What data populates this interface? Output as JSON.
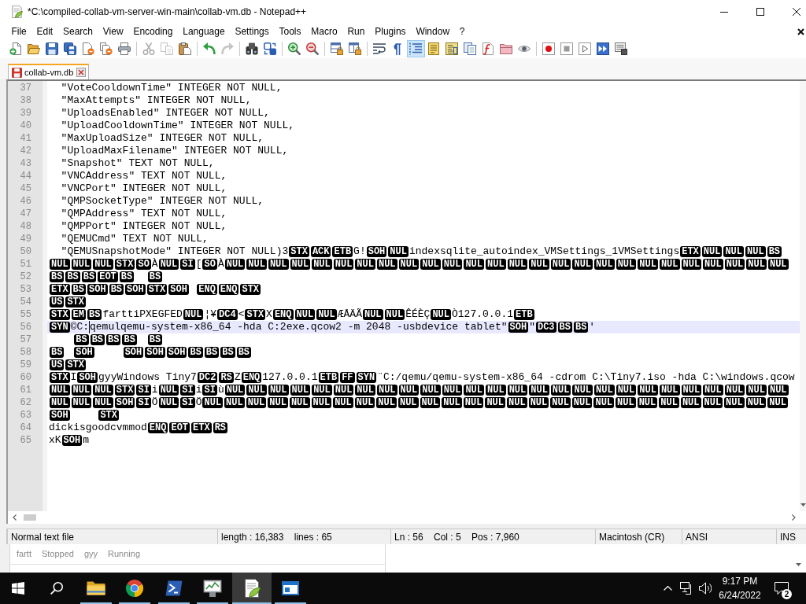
{
  "window": {
    "title": "*C:\\compiled-collab-vm-server-win-main\\collab-vm.db - Notepad++"
  },
  "menu": [
    "File",
    "Edit",
    "Search",
    "View",
    "Encoding",
    "Language",
    "Settings",
    "Tools",
    "Macro",
    "Run",
    "Plugins",
    "Window",
    "?"
  ],
  "toolbar": [
    {
      "buttons": [
        {
          "kind": "new",
          "pressed": false,
          "disabled": false
        },
        {
          "kind": "open",
          "pressed": false,
          "disabled": false
        },
        {
          "kind": "save",
          "pressed": false,
          "disabled": false
        },
        {
          "kind": "save_all",
          "pressed": false,
          "disabled": false
        },
        {
          "kind": "close",
          "pressed": false,
          "disabled": false
        },
        {
          "kind": "close_all",
          "pressed": false,
          "disabled": false
        },
        {
          "kind": "print",
          "pressed": false,
          "disabled": false
        }
      ]
    },
    {
      "buttons": [
        {
          "kind": "cut",
          "pressed": false,
          "disabled": true
        },
        {
          "kind": "copy",
          "pressed": false,
          "disabled": true
        },
        {
          "kind": "paste",
          "pressed": false,
          "disabled": false
        }
      ]
    },
    {
      "buttons": [
        {
          "kind": "undo",
          "pressed": false,
          "disabled": false
        },
        {
          "kind": "redo",
          "pressed": false,
          "disabled": true
        }
      ]
    },
    {
      "buttons": [
        {
          "kind": "find",
          "pressed": false,
          "disabled": false
        },
        {
          "kind": "replace",
          "pressed": false,
          "disabled": false
        }
      ]
    },
    {
      "buttons": [
        {
          "kind": "zoom_in",
          "pressed": false,
          "disabled": false
        },
        {
          "kind": "zoom_out",
          "pressed": false,
          "disabled": false
        }
      ]
    },
    {
      "buttons": [
        {
          "kind": "sync_v",
          "pressed": false,
          "disabled": false
        },
        {
          "kind": "sync_h",
          "pressed": false,
          "disabled": false
        }
      ]
    },
    {
      "buttons": [
        {
          "kind": "wrap",
          "pressed": false,
          "disabled": false
        },
        {
          "kind": "all_chars",
          "pressed": false,
          "disabled": false
        },
        {
          "kind": "indent_guide",
          "pressed": true,
          "disabled": false
        },
        {
          "kind": "udl",
          "pressed": false,
          "disabled": false
        },
        {
          "kind": "doc_map",
          "pressed": false,
          "disabled": false
        },
        {
          "kind": "doc_list",
          "pressed": false,
          "disabled": false
        },
        {
          "kind": "function_list",
          "pressed": false,
          "disabled": false
        },
        {
          "kind": "folder",
          "pressed": false,
          "disabled": false
        },
        {
          "kind": "monitor",
          "pressed": false,
          "disabled": false
        }
      ]
    },
    {
      "buttons": [
        {
          "kind": "record",
          "pressed": false,
          "disabled": false
        },
        {
          "kind": "stop",
          "pressed": false,
          "disabled": false
        },
        {
          "kind": "play",
          "pressed": false,
          "disabled": false
        },
        {
          "kind": "play_multi",
          "pressed": false,
          "disabled": false
        },
        {
          "kind": "save_macro",
          "pressed": false,
          "disabled": false
        }
      ]
    }
  ],
  "tabs": [
    {
      "label": "collab-vm.db",
      "selected": true,
      "modified": true
    }
  ],
  "editor": {
    "lines": [
      {
        "number": "37",
        "current": false,
        "segments": [
          {
            "kind": "text",
            "text": "  \"VoteCooldownTime\" INTEGER NOT NULL,"
          }
        ]
      },
      {
        "number": "38",
        "current": false,
        "segments": [
          {
            "kind": "text",
            "text": "  \"MaxAttempts\" INTEGER NOT NULL,"
          }
        ]
      },
      {
        "number": "39",
        "current": false,
        "segments": [
          {
            "kind": "text",
            "text": "  \"UploadsEnabled\" INTEGER NOT NULL,"
          }
        ]
      },
      {
        "number": "40",
        "current": false,
        "segments": [
          {
            "kind": "text",
            "text": "  \"UploadCooldownTime\" INTEGER NOT NULL,"
          }
        ]
      },
      {
        "number": "41",
        "current": false,
        "segments": [
          {
            "kind": "text",
            "text": "  \"MaxUploadSize\" INTEGER NOT NULL,"
          }
        ]
      },
      {
        "number": "42",
        "current": false,
        "segments": [
          {
            "kind": "text",
            "text": "  \"UploadMaxFilename\" INTEGER NOT NULL,"
          }
        ]
      },
      {
        "number": "43",
        "current": false,
        "segments": [
          {
            "kind": "text",
            "text": "  \"Snapshot\" TEXT NOT NULL,"
          }
        ]
      },
      {
        "number": "44",
        "current": false,
        "segments": [
          {
            "kind": "text",
            "text": "  \"VNCAddress\" TEXT NOT NULL,"
          }
        ]
      },
      {
        "number": "45",
        "current": false,
        "segments": [
          {
            "kind": "text",
            "text": "  \"VNCPort\" INTEGER NOT NULL,"
          }
        ]
      },
      {
        "number": "46",
        "current": false,
        "segments": [
          {
            "kind": "text",
            "text": "  \"QMPSocketType\" INTEGER NOT NULL,"
          }
        ]
      },
      {
        "number": "47",
        "current": false,
        "segments": [
          {
            "kind": "text",
            "text": "  \"QMPAddress\" TEXT NOT NULL,"
          }
        ]
      },
      {
        "number": "48",
        "current": false,
        "segments": [
          {
            "kind": "text",
            "text": "  \"QMPPort\" INTEGER NOT NULL,"
          }
        ]
      },
      {
        "number": "49",
        "current": false,
        "segments": [
          {
            "kind": "text",
            "text": "  \"QEMUCmd\" TEXT NOT NULL,"
          }
        ]
      },
      {
        "number": "50",
        "current": false,
        "segments": [
          {
            "kind": "text",
            "text": "  \"QEMUSnapshotMode\" INTEGER NOT NULL)3"
          },
          {
            "kind": "control",
            "text": "STX"
          },
          {
            "kind": "control",
            "text": "ACK"
          },
          {
            "kind": "control",
            "text": "ETB"
          },
          {
            "kind": "text",
            "text": "G!"
          },
          {
            "kind": "control",
            "text": "SOH"
          },
          {
            "kind": "control",
            "text": "NUL"
          },
          {
            "kind": "text",
            "text": "indexsqlite_autoindex_VMSettings_1VMSettings"
          },
          {
            "kind": "control",
            "text": "ETX"
          },
          {
            "kind": "control",
            "text": "NUL"
          },
          {
            "kind": "control",
            "text": "NUL"
          },
          {
            "kind": "control",
            "text": "NUL"
          },
          {
            "kind": "control",
            "text": "BS"
          }
        ]
      },
      {
        "number": "51",
        "current": false,
        "segments": [
          {
            "kind": "control",
            "text": "NUL"
          },
          {
            "kind": "control",
            "text": "NUL"
          },
          {
            "kind": "control",
            "text": "NUL"
          },
          {
            "kind": "control",
            "text": "STX"
          },
          {
            "kind": "control",
            "text": "SO"
          },
          {
            "kind": "text",
            "text": "À"
          },
          {
            "kind": "control",
            "text": "NUL"
          },
          {
            "kind": "control",
            "text": "SI"
          },
          {
            "kind": "text",
            "text": "["
          },
          {
            "kind": "control",
            "text": "SO"
          },
          {
            "kind": "text",
            "text": "À"
          },
          {
            "kind": "control",
            "text": "NUL"
          },
          {
            "kind": "control",
            "text": "NUL"
          },
          {
            "kind": "control",
            "text": "NUL"
          },
          {
            "kind": "control",
            "text": "NUL"
          },
          {
            "kind": "control",
            "text": "NUL"
          },
          {
            "kind": "control",
            "text": "NUL"
          },
          {
            "kind": "control",
            "text": "NUL"
          },
          {
            "kind": "control",
            "text": "NUL"
          },
          {
            "kind": "control",
            "text": "NUL"
          },
          {
            "kind": "control",
            "text": "NUL"
          },
          {
            "kind": "control",
            "text": "NUL"
          },
          {
            "kind": "control",
            "text": "NUL"
          },
          {
            "kind": "control",
            "text": "NUL"
          },
          {
            "kind": "control",
            "text": "NUL"
          },
          {
            "kind": "control",
            "text": "NUL"
          },
          {
            "kind": "control",
            "text": "NUL"
          },
          {
            "kind": "control",
            "text": "NUL"
          },
          {
            "kind": "control",
            "text": "NUL"
          },
          {
            "kind": "control",
            "text": "NUL"
          },
          {
            "kind": "control",
            "text": "NUL"
          },
          {
            "kind": "control",
            "text": "NUL"
          },
          {
            "kind": "control",
            "text": "NUL"
          },
          {
            "kind": "control",
            "text": "NUL"
          },
          {
            "kind": "control",
            "text": "NUL"
          },
          {
            "kind": "control",
            "text": "NUL"
          },
          {
            "kind": "control",
            "text": "NUL"
          }
        ]
      },
      {
        "number": "52",
        "current": false,
        "segments": [
          {
            "kind": "control",
            "text": "BS"
          },
          {
            "kind": "control",
            "text": "BS"
          },
          {
            "kind": "control",
            "text": "BS"
          },
          {
            "kind": "control",
            "text": "EOT"
          },
          {
            "kind": "control",
            "text": "BS"
          },
          {
            "kind": "tab"
          },
          {
            "kind": "control",
            "text": "BS"
          }
        ]
      },
      {
        "number": "53",
        "current": false,
        "segments": [
          {
            "kind": "control",
            "text": "ETX"
          },
          {
            "kind": "control",
            "text": "BS"
          },
          {
            "kind": "control",
            "text": "SOH"
          },
          {
            "kind": "control",
            "text": "BS"
          },
          {
            "kind": "control",
            "text": "SOH"
          },
          {
            "kind": "control",
            "text": "STX"
          },
          {
            "kind": "control",
            "text": "SOH"
          },
          {
            "kind": "tab"
          },
          {
            "kind": "control",
            "text": "ENQ"
          },
          {
            "kind": "control",
            "text": "ENQ"
          },
          {
            "kind": "control",
            "text": "STX"
          }
        ]
      },
      {
        "number": "54",
        "current": false,
        "segments": [
          {
            "kind": "control",
            "text": "US"
          },
          {
            "kind": "control",
            "text": "STX"
          }
        ]
      },
      {
        "number": "55",
        "current": false,
        "segments": [
          {
            "kind": "control",
            "text": "STX"
          },
          {
            "kind": "control",
            "text": "EM"
          },
          {
            "kind": "control",
            "text": "BS"
          },
          {
            "kind": "text",
            "text": "farttiPXEGFED"
          },
          {
            "kind": "control",
            "text": "NUL"
          },
          {
            "kind": "text",
            "text": "¦¥"
          },
          {
            "kind": "control",
            "text": "DC4"
          },
          {
            "kind": "text",
            "text": "<"
          },
          {
            "kind": "control",
            "text": "STX"
          },
          {
            "kind": "text",
            "text": "X"
          },
          {
            "kind": "control",
            "text": "ENQ"
          },
          {
            "kind": "control",
            "text": "NUL"
          },
          {
            "kind": "control",
            "text": "NUL"
          },
          {
            "kind": "text",
            "text": "ÆÅÄÃ"
          },
          {
            "kind": "control",
            "text": "NUL"
          },
          {
            "kind": "control",
            "text": "NUL"
          },
          {
            "kind": "text",
            "text": "ÊÉÈÇ"
          },
          {
            "kind": "control",
            "text": "NUL"
          },
          {
            "kind": "text",
            "text": "Ò127.0.0.1"
          },
          {
            "kind": "control",
            "text": "ETB"
          }
        ]
      },
      {
        "number": "56",
        "current": true,
        "segments": [
          {
            "kind": "control",
            "text": "SYN"
          },
          {
            "kind": "text",
            "text": "©C:"
          },
          {
            "kind": "caret"
          },
          {
            "kind": "text",
            "text": "qemulqemu-system-x86_64 -hda C:2exe.qcow2 -m 2048 -usbdevice tablet\""
          },
          {
            "kind": "control",
            "text": "SOH"
          },
          {
            "kind": "text",
            "text": "\""
          },
          {
            "kind": "control",
            "text": "DC3"
          },
          {
            "kind": "control",
            "text": "BS"
          },
          {
            "kind": "control",
            "text": "BS"
          },
          {
            "kind": "text",
            "text": "'"
          }
        ]
      },
      {
        "number": "57",
        "current": false,
        "segments": [
          {
            "kind": "tab"
          },
          {
            "kind": "control",
            "text": "BS"
          },
          {
            "kind": "control",
            "text": "BS"
          },
          {
            "kind": "control",
            "text": "BS"
          },
          {
            "kind": "control",
            "text": "BS"
          },
          {
            "kind": "tab"
          },
          {
            "kind": "control",
            "text": "BS"
          }
        ]
      },
      {
        "number": "58",
        "current": false,
        "segments": [
          {
            "kind": "control",
            "text": "BS"
          },
          {
            "kind": "tab"
          },
          {
            "kind": "control",
            "text": "SOH"
          },
          {
            "kind": "tab"
          },
          {
            "kind": "control",
            "text": "SOH"
          },
          {
            "kind": "control",
            "text": "SOH"
          },
          {
            "kind": "control",
            "text": "SOH"
          },
          {
            "kind": "control",
            "text": "BS"
          },
          {
            "kind": "control",
            "text": "BS"
          },
          {
            "kind": "control",
            "text": "BS"
          },
          {
            "kind": "control",
            "text": "BS"
          }
        ]
      },
      {
        "number": "59",
        "current": false,
        "segments": [
          {
            "kind": "control",
            "text": "US"
          },
          {
            "kind": "control",
            "text": "STX"
          }
        ]
      },
      {
        "number": "60",
        "current": false,
        "segments": [
          {
            "kind": "control",
            "text": "STX"
          },
          {
            "kind": "text",
            "text": "I"
          },
          {
            "kind": "control",
            "text": "SOH"
          },
          {
            "kind": "text",
            "text": "gyyWindows Tiny7"
          },
          {
            "kind": "control",
            "text": "DC2"
          },
          {
            "kind": "control",
            "text": "RS"
          },
          {
            "kind": "text",
            "text": "Z"
          },
          {
            "kind": "control",
            "text": "ENQ"
          },
          {
            "kind": "text",
            "text": "127.0.0.1"
          },
          {
            "kind": "control",
            "text": "ETB"
          },
          {
            "kind": "control",
            "text": "FF"
          },
          {
            "kind": "control",
            "text": "SYN"
          },
          {
            "kind": "text",
            "text": "¨C:/qemu/qemu-system-x86_64 -cdrom C:\\Tiny7.iso -hda C:\\windows.qcow"
          }
        ]
      },
      {
        "number": "61",
        "current": false,
        "segments": [
          {
            "kind": "control",
            "text": "NUL"
          },
          {
            "kind": "control",
            "text": "NUL"
          },
          {
            "kind": "control",
            "text": "NUL"
          },
          {
            "kind": "control",
            "text": "STX"
          },
          {
            "kind": "control",
            "text": "SI"
          },
          {
            "kind": "text",
            "text": "i"
          },
          {
            "kind": "control",
            "text": "NUL"
          },
          {
            "kind": "control",
            "text": "SI"
          },
          {
            "kind": "text",
            "text": "i"
          },
          {
            "kind": "control",
            "text": "SI"
          },
          {
            "kind": "text",
            "text": "ù"
          },
          {
            "kind": "control",
            "text": "NUL"
          },
          {
            "kind": "control",
            "text": "NUL"
          },
          {
            "kind": "control",
            "text": "NUL"
          },
          {
            "kind": "control",
            "text": "NUL"
          },
          {
            "kind": "control",
            "text": "NUL"
          },
          {
            "kind": "control",
            "text": "NUL"
          },
          {
            "kind": "control",
            "text": "NUL"
          },
          {
            "kind": "control",
            "text": "NUL"
          },
          {
            "kind": "control",
            "text": "NUL"
          },
          {
            "kind": "control",
            "text": "NUL"
          },
          {
            "kind": "control",
            "text": "NUL"
          },
          {
            "kind": "control",
            "text": "NUL"
          },
          {
            "kind": "control",
            "text": "NUL"
          },
          {
            "kind": "control",
            "text": "NUL"
          },
          {
            "kind": "control",
            "text": "NUL"
          },
          {
            "kind": "control",
            "text": "NUL"
          },
          {
            "kind": "control",
            "text": "NUL"
          },
          {
            "kind": "control",
            "text": "NUL"
          },
          {
            "kind": "control",
            "text": "NUL"
          },
          {
            "kind": "control",
            "text": "NUL"
          },
          {
            "kind": "control",
            "text": "NUL"
          },
          {
            "kind": "control",
            "text": "NUL"
          },
          {
            "kind": "control",
            "text": "NUL"
          },
          {
            "kind": "control",
            "text": "NUL"
          },
          {
            "kind": "control",
            "text": "NUL"
          },
          {
            "kind": "control",
            "text": "NUL"
          }
        ]
      },
      {
        "number": "62",
        "current": false,
        "segments": [
          {
            "kind": "control",
            "text": "NUL"
          },
          {
            "kind": "control",
            "text": "NUL"
          },
          {
            "kind": "control",
            "text": "NUL"
          },
          {
            "kind": "control",
            "text": "SOH"
          },
          {
            "kind": "control",
            "text": "SI"
          },
          {
            "kind": "text",
            "text": "Ö"
          },
          {
            "kind": "control",
            "text": "NUL"
          },
          {
            "kind": "control",
            "text": "SI"
          },
          {
            "kind": "text",
            "text": "Ö"
          },
          {
            "kind": "control",
            "text": "NUL"
          },
          {
            "kind": "control",
            "text": "NUL"
          },
          {
            "kind": "control",
            "text": "NUL"
          },
          {
            "kind": "control",
            "text": "NUL"
          },
          {
            "kind": "control",
            "text": "NUL"
          },
          {
            "kind": "control",
            "text": "NUL"
          },
          {
            "kind": "control",
            "text": "NUL"
          },
          {
            "kind": "control",
            "text": "NUL"
          },
          {
            "kind": "control",
            "text": "NUL"
          },
          {
            "kind": "control",
            "text": "NUL"
          },
          {
            "kind": "control",
            "text": "NUL"
          },
          {
            "kind": "control",
            "text": "NUL"
          },
          {
            "kind": "control",
            "text": "NUL"
          },
          {
            "kind": "control",
            "text": "NUL"
          },
          {
            "kind": "control",
            "text": "NUL"
          },
          {
            "kind": "control",
            "text": "NUL"
          },
          {
            "kind": "control",
            "text": "NUL"
          },
          {
            "kind": "control",
            "text": "NUL"
          },
          {
            "kind": "control",
            "text": "NUL"
          },
          {
            "kind": "control",
            "text": "NUL"
          },
          {
            "kind": "control",
            "text": "NUL"
          },
          {
            "kind": "control",
            "text": "NUL"
          },
          {
            "kind": "control",
            "text": "NUL"
          },
          {
            "kind": "control",
            "text": "NUL"
          },
          {
            "kind": "control",
            "text": "NUL"
          },
          {
            "kind": "control",
            "text": "NUL"
          },
          {
            "kind": "control",
            "text": "NUL"
          }
        ]
      },
      {
        "number": "63",
        "current": false,
        "segments": [
          {
            "kind": "control",
            "text": "SOH"
          },
          {
            "kind": "tab"
          },
          {
            "kind": "control",
            "text": "STX"
          }
        ]
      },
      {
        "number": "64",
        "current": false,
        "segments": [
          {
            "kind": "text",
            "text": "dickisgoodcvmmod"
          },
          {
            "kind": "control",
            "text": "ENQ"
          },
          {
            "kind": "control",
            "text": "EOT"
          },
          {
            "kind": "control",
            "text": "ETX"
          },
          {
            "kind": "control",
            "text": "RS"
          }
        ]
      },
      {
        "number": "65",
        "current": false,
        "segments": [
          {
            "kind": "text",
            "text": "xK"
          },
          {
            "kind": "control",
            "text": "SOH"
          },
          {
            "kind": "text",
            "text": "m"
          }
        ]
      }
    ]
  },
  "status_bar": {
    "file_type": "Normal text file",
    "document_size": "length : 16,383    lines : 65",
    "cursor": "Ln : 56    Col : 5    Pos : 7,960",
    "line_endings": "Macintosh (CR)",
    "encoding": "ANSI",
    "mode": "INS"
  },
  "background_window": {
    "vms": [
      {
        "name": "fartt",
        "status": "Stopped"
      },
      {
        "name": "gyy",
        "status": "Running"
      }
    ]
  },
  "taskbar": {
    "apps": [
      {
        "kind": "folder",
        "running": true,
        "active": false
      },
      {
        "kind": "browser",
        "running": true,
        "active": false
      },
      {
        "kind": "terminal",
        "running": true,
        "active": false
      },
      {
        "kind": "monitor",
        "running": true,
        "active": false
      },
      {
        "kind": "notepad",
        "running": true,
        "active": true
      },
      {
        "kind": "window",
        "running": true,
        "active": false
      }
    ],
    "clock": {
      "time": "9:17 PM",
      "date": "6/24/2022"
    },
    "notification_count": "2"
  }
}
